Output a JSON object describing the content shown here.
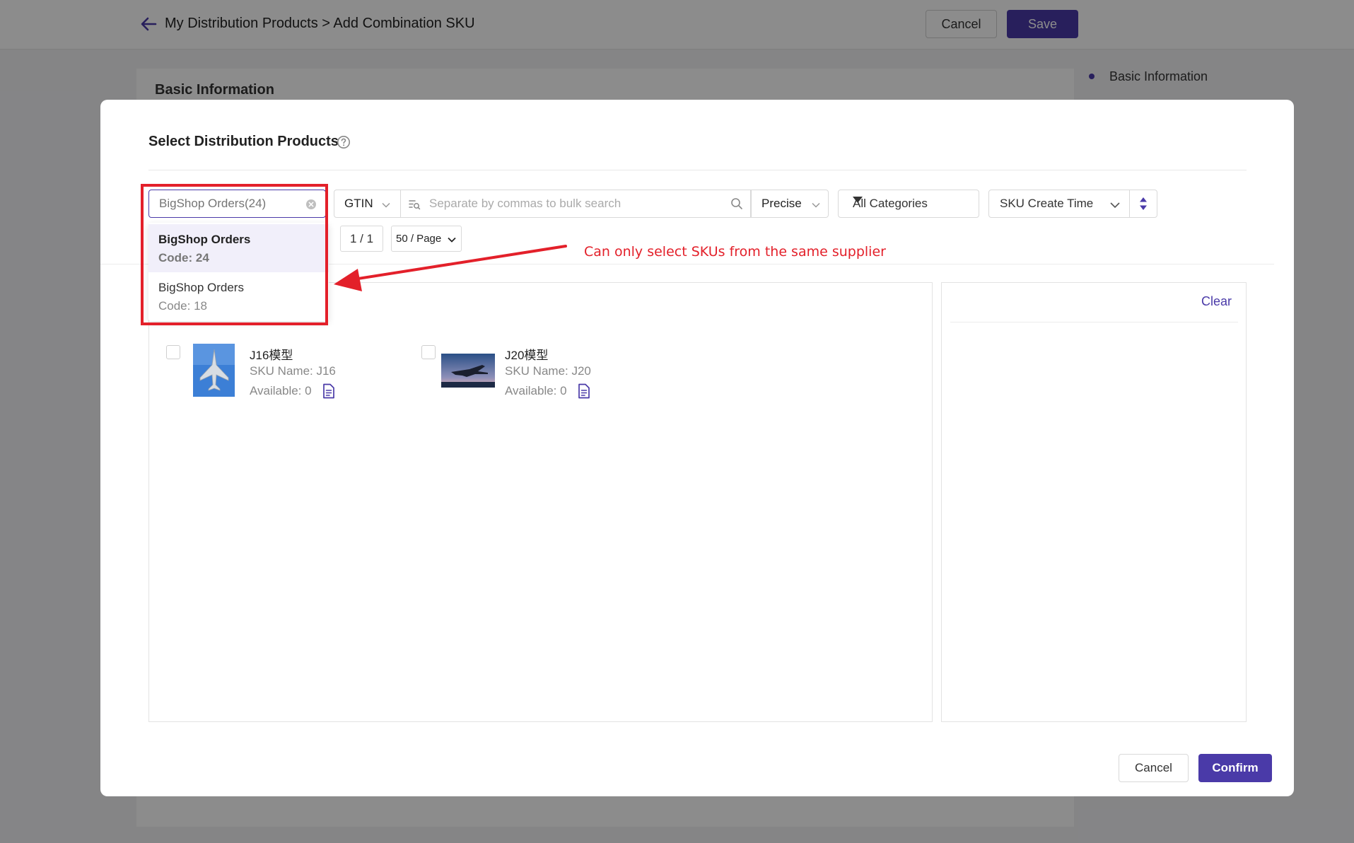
{
  "header": {
    "breadcrumb": "My Distribution Products > Add Combination SKU",
    "cancel_label": "Cancel",
    "save_label": "Save"
  },
  "background": {
    "card_title": "Basic Information",
    "side_nav": [
      "Basic Information"
    ]
  },
  "modal": {
    "title": "Select Distribution Products",
    "filters": {
      "supplier_placeholder": "BigShop Orders(24)",
      "gtin_label": "GTIN",
      "search_placeholder": "Separate by commas to bulk search",
      "match_mode": "Precise",
      "category": "All Categories",
      "sort_field": "SKU Create Time"
    },
    "pagination": {
      "page": "1 / 1",
      "page_size": "50 / Page"
    },
    "supplier_dropdown": [
      {
        "name": "BigShop Orders",
        "code": "Code: 24",
        "selected": true
      },
      {
        "name": "BigShop Orders",
        "code": "Code: 18",
        "selected": false
      }
    ],
    "products": [
      {
        "name": "J16模型",
        "sku": "SKU Name: J16",
        "available": "Available: 0"
      },
      {
        "name": "J20模型",
        "sku": "SKU Name: J20",
        "available": "Available: 0"
      }
    ],
    "selected_panel": {
      "clear_label": "Clear"
    },
    "cancel_label": "Cancel",
    "confirm_label": "Confirm"
  },
  "annotation": {
    "text": "Can only select SKUs from the same supplier"
  },
  "colors": {
    "accent": "#4a3aa8",
    "annotation": "#e3202a"
  }
}
